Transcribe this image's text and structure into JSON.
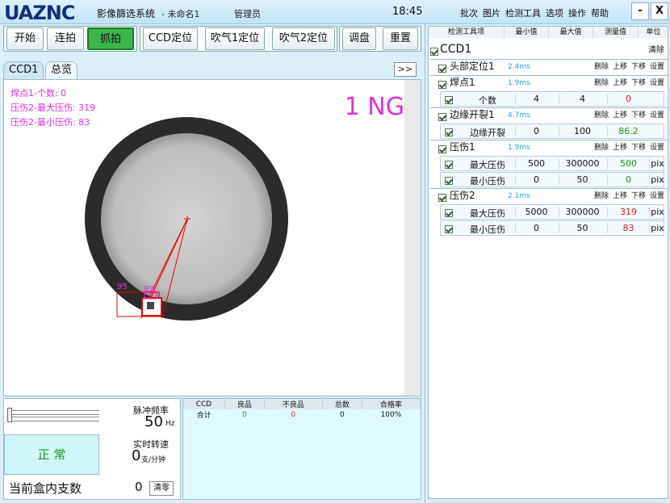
{
  "title_bar": {
    "logo": "UAZNC",
    "app_title": "影像篩选系统",
    "file_name": "- 未命名1",
    "user_role": "管理员",
    "clock": "18:45",
    "menu": [
      "批次",
      "图片",
      "检测工具",
      "选项",
      "操作",
      "帮助"
    ],
    "minimize": "-",
    "close": "X"
  },
  "toolbar": {
    "start": "开始",
    "continuous": "连拍",
    "capture": "抓拍",
    "ccd_position": "CCD定位",
    "blow1_position": "吹气1定位",
    "blow2_position": "吹气2定位",
    "adjust_disk": "调盘",
    "reset": "重置"
  },
  "tabs": {
    "ccd1": "CCD1",
    "overview": "总览",
    "next": ">>"
  },
  "viewer": {
    "overlay_lines": [
      "焊点1-个数: 0",
      "压伤2-最大压伤: 319",
      "压伤2-最小压伤: 83"
    ],
    "result_text": "1 NG",
    "marker_labels": [
      "95",
      "89"
    ]
  },
  "status": {
    "pulse_freq_label": "脉冲频率",
    "pulse_freq_value": "50",
    "pulse_freq_unit": "Hz",
    "state": "正 常",
    "speed_label": "实时转速",
    "speed_value": "0",
    "speed_unit": "支/分钟",
    "box_count_label": "当前盒内支数",
    "box_count_value": "0",
    "clear_button": "清零",
    "slider_level": 0
  },
  "stats": {
    "headers": [
      "CCD",
      "良品",
      "不良品",
      "总数",
      "合格率"
    ],
    "rows": [
      [
        "合计",
        "0",
        "0",
        "0",
        "100%"
      ]
    ]
  },
  "params": {
    "headers": [
      "检测工具项",
      "最小值",
      "最大值",
      "测量值",
      "单位"
    ],
    "root": "CCD1",
    "clear": "清除",
    "actions": [
      "删除",
      "上移",
      "下移",
      "设置"
    ],
    "groups": [
      {
        "name": "头部定位1",
        "time": "2.4ms",
        "rows": []
      },
      {
        "name": "焊点1",
        "time": "1.9ms",
        "rows": [
          {
            "name": "个数",
            "min": "4",
            "max": "4",
            "value": "0",
            "unit": "",
            "status": "fail"
          }
        ]
      },
      {
        "name": "边缘开裂1",
        "time": "4.7ms",
        "rows": [
          {
            "name": "边缘开裂",
            "min": "0",
            "max": "100",
            "value": "86.2",
            "unit": "",
            "status": "ok"
          }
        ]
      },
      {
        "name": "压伤1",
        "time": "1.9ms",
        "rows": [
          {
            "name": "最大压伤",
            "min": "500",
            "max": "300000",
            "value": "500",
            "unit": "pix",
            "status": "ok"
          },
          {
            "name": "最小压伤",
            "min": "0",
            "max": "50",
            "value": "0",
            "unit": "pix",
            "status": "ok"
          }
        ]
      },
      {
        "name": "压伤2",
        "time": "2.1ms",
        "rows": [
          {
            "name": "最大压伤",
            "min": "5000",
            "max": "300000",
            "value": "319",
            "unit": "pix",
            "status": "fail"
          },
          {
            "name": "最小压伤",
            "min": "0",
            "max": "50",
            "value": "83",
            "unit": "pix",
            "status": "fail"
          }
        ]
      }
    ]
  },
  "colors": {
    "ok": "#1a9a1a",
    "fail": "#e02020",
    "accent": "#e22ee2",
    "capture_active": "#3cb54a"
  }
}
